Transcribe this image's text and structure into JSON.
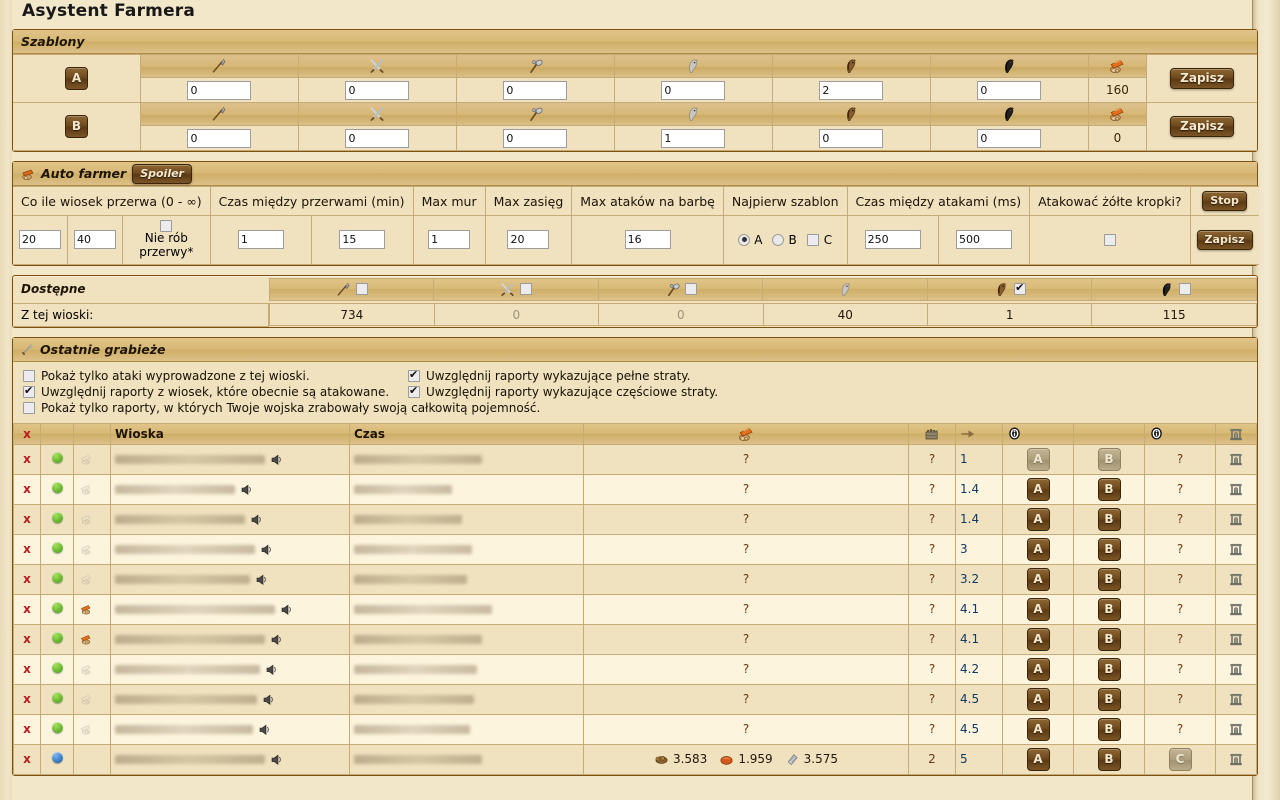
{
  "page": {
    "title": "Asystent Farmera"
  },
  "templates": {
    "header": "Szablony",
    "unit_icons": [
      "spear-icon",
      "sword-icon",
      "axe-icon",
      "scout-icon",
      "light-cavalry-icon",
      "heavy-cavalry-icon",
      "loot-icon"
    ],
    "save_label": "Zapisz",
    "rows": [
      {
        "name": "A",
        "values": [
          "0",
          "0",
          "0",
          "0",
          "2",
          "0"
        ],
        "capacity": "160"
      },
      {
        "name": "B",
        "values": [
          "0",
          "0",
          "0",
          "1",
          "0",
          "0"
        ],
        "capacity": "0"
      }
    ]
  },
  "autofarm": {
    "header": "Auto farmer",
    "spoiler_label": "Spoiler",
    "stop_label": "Stop",
    "save_label": "Zapisz",
    "headers": [
      "Co ile wiosek przerwa (0 - ∞)",
      "Czas między przerwami (min)",
      "Max mur",
      "Max zasięg",
      "Max ataków na barbę",
      "Najpierw szablon",
      "Czas między atakami (ms)",
      "Atakować żółte kropki?"
    ],
    "break_from": "20",
    "break_to": "40",
    "no_break_label": "Nie rób przerwy*",
    "no_break_checked": false,
    "break_time_from": "1",
    "break_time_to": "15",
    "max_wall": "1",
    "max_range": "20",
    "max_attacks_barb": "16",
    "template_options": [
      {
        "label": "A",
        "type": "radio",
        "checked": true
      },
      {
        "label": "B",
        "type": "radio",
        "checked": false
      },
      {
        "label": "C",
        "type": "checkbox",
        "checked": false
      }
    ],
    "attack_delay_from": "250",
    "attack_delay_to": "500",
    "attack_yellow_checked": false
  },
  "available": {
    "header": "Dostępne",
    "row_label": "Z tej wioski:",
    "units": [
      {
        "icon": "spear-icon",
        "has_checkbox": true,
        "checked": false,
        "value": "734",
        "zero": false
      },
      {
        "icon": "sword-icon",
        "has_checkbox": true,
        "checked": false,
        "value": "0",
        "zero": true
      },
      {
        "icon": "axe-icon",
        "has_checkbox": true,
        "checked": false,
        "value": "0",
        "zero": true
      },
      {
        "icon": "scout-icon",
        "has_checkbox": false,
        "checked": false,
        "value": "40",
        "zero": false
      },
      {
        "icon": "light-cavalry-icon",
        "has_checkbox": true,
        "checked": true,
        "value": "1",
        "zero": false
      },
      {
        "icon": "heavy-cavalry-icon",
        "has_checkbox": true,
        "checked": false,
        "value": "115",
        "zero": false
      }
    ]
  },
  "raids": {
    "header": "Ostatnie grabieże",
    "filters": [
      {
        "label": "Pokaż tylko ataki wyprowadzone z tej wioski.",
        "checked": false
      },
      {
        "label": "Uwzględnij raporty wykazujące pełne straty.",
        "checked": true
      },
      {
        "label": "Uwzględnij raporty z wiosek, które obecnie są atakowane.",
        "checked": true
      },
      {
        "label": "Uwzględnij raporty wykazujące częściowe straty.",
        "checked": true
      },
      {
        "label": "Pokaż tylko raporty, w których Twoje wojska zrabowały swoją całkowitą pojemność.",
        "checked": false
      }
    ],
    "columns": {
      "delete": "x",
      "status": "",
      "flag": "",
      "village": "Wioska",
      "time": "Czas",
      "loot": "loot-icon",
      "wall": "wall-icon",
      "distance": "distance-icon",
      "attack_a": "info-icon",
      "attack_b": "",
      "info": "info-icon",
      "building": "building-icon"
    },
    "row_defaults": {
      "delete": "x",
      "unknown": "?",
      "a_label": "A",
      "b_label": "B",
      "c_label": "C"
    },
    "rows": [
      {
        "dot": "green",
        "flag": "dim",
        "loot": "?",
        "wall": "?",
        "distance": "1",
        "info": "?",
        "a_disabled": true,
        "b_disabled": true,
        "has_c": false
      },
      {
        "dot": "green",
        "flag": "dim",
        "loot": "?",
        "wall": "?",
        "distance": "1.4",
        "info": "?",
        "a_disabled": false,
        "b_disabled": false,
        "has_c": false
      },
      {
        "dot": "green",
        "flag": "dim",
        "loot": "?",
        "wall": "?",
        "distance": "1.4",
        "info": "?",
        "a_disabled": false,
        "b_disabled": false,
        "has_c": false
      },
      {
        "dot": "green",
        "flag": "dim",
        "loot": "?",
        "wall": "?",
        "distance": "3",
        "info": "?",
        "a_disabled": false,
        "b_disabled": false,
        "has_c": false
      },
      {
        "dot": "green",
        "flag": "dim",
        "loot": "?",
        "wall": "?",
        "distance": "3.2",
        "info": "?",
        "a_disabled": false,
        "b_disabled": false,
        "has_c": false
      },
      {
        "dot": "green",
        "flag": "color",
        "loot": "?",
        "wall": "?",
        "distance": "4.1",
        "info": "?",
        "a_disabled": false,
        "b_disabled": false,
        "has_c": false
      },
      {
        "dot": "green",
        "flag": "color",
        "loot": "?",
        "wall": "?",
        "distance": "4.1",
        "info": "?",
        "a_disabled": false,
        "b_disabled": false,
        "has_c": false
      },
      {
        "dot": "green",
        "flag": "dim",
        "loot": "?",
        "wall": "?",
        "distance": "4.2",
        "info": "?",
        "a_disabled": false,
        "b_disabled": false,
        "has_c": false
      },
      {
        "dot": "green",
        "flag": "dim",
        "loot": "?",
        "wall": "?",
        "distance": "4.5",
        "info": "?",
        "a_disabled": false,
        "b_disabled": false,
        "has_c": false
      },
      {
        "dot": "green",
        "flag": "dim",
        "loot": "?",
        "wall": "?",
        "distance": "4.5",
        "info": "?",
        "a_disabled": false,
        "b_disabled": false,
        "has_c": false
      },
      {
        "dot": "blue",
        "flag": "none",
        "loot_res": [
          {
            "icon": "wood-icon",
            "value": "3.583"
          },
          {
            "icon": "clay-icon",
            "value": "1.959"
          },
          {
            "icon": "iron-icon",
            "value": "3.575"
          }
        ],
        "wall": "2",
        "distance": "5",
        "info": "C",
        "a_disabled": false,
        "b_disabled": false,
        "has_c": true
      }
    ]
  }
}
